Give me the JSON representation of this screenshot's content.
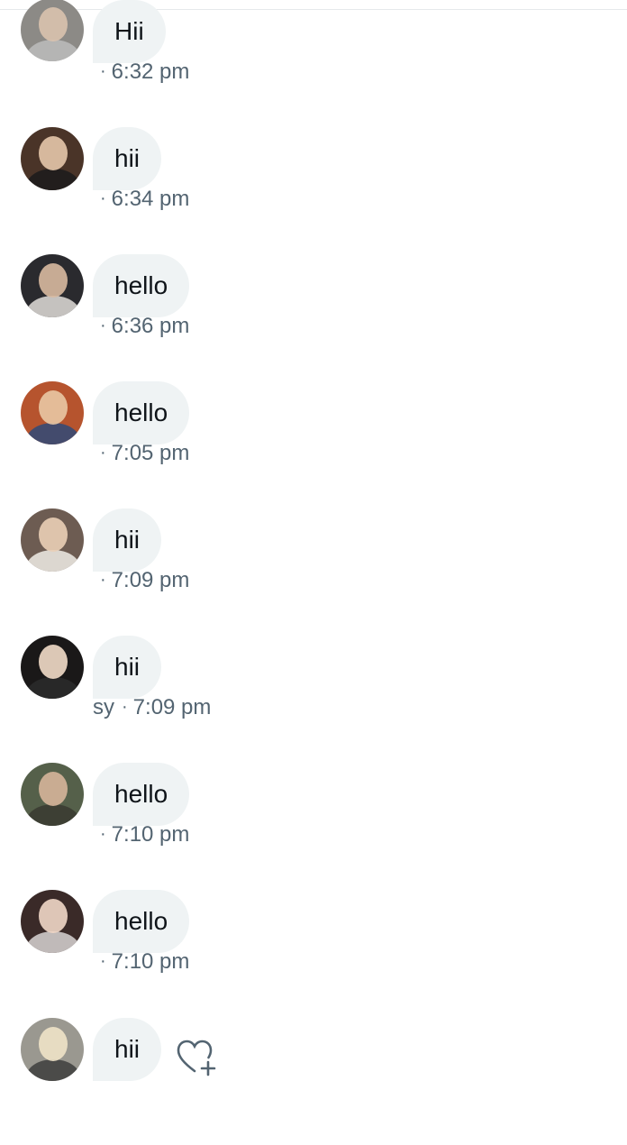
{
  "messages": [
    {
      "text": "Hii",
      "time": "6:32 pm",
      "sender_clip": "",
      "avatar": {
        "bg": "#8c8a86",
        "head": "#d9c2ae",
        "body": "#bcbcbc"
      }
    },
    {
      "text": "hii",
      "time": "6:34 pm",
      "sender_clip": "",
      "avatar": {
        "bg": "#4a3428",
        "head": "#e6c6aa",
        "body": "#1b1b1b"
      }
    },
    {
      "text": "hello",
      "time": "6:36 pm",
      "sender_clip": "",
      "avatar": {
        "bg": "#2a2a2e",
        "head": "#d8b9a0",
        "body": "#e0ddd8"
      }
    },
    {
      "text": "hello",
      "time": "7:05 pm",
      "sender_clip": "",
      "avatar": {
        "bg": "#b6542e",
        "head": "#e9c8a4",
        "body": "#2f4a78"
      }
    },
    {
      "text": "hii",
      "time": "7:09 pm",
      "sender_clip": "",
      "avatar": {
        "bg": "#6d5c52",
        "head": "#eacfb6",
        "body": "#f0ece6"
      }
    },
    {
      "text": "hii",
      "time": "7:09 pm",
      "sender_clip": "sy",
      "avatar": {
        "bg": "#1a1818",
        "head": "#f2dcc8",
        "body": "#2b2b2b"
      }
    },
    {
      "text": "hello",
      "time": "7:10 pm",
      "sender_clip": "",
      "avatar": {
        "bg": "#55604a",
        "head": "#d6b59a",
        "body": "#3a3a30"
      }
    },
    {
      "text": "hello",
      "time": "7:10 pm",
      "sender_clip": "",
      "avatar": {
        "bg": "#3a2a28",
        "head": "#f1d7c6",
        "body": "#d8d4d2"
      }
    },
    {
      "text": "hii",
      "time": "",
      "sender_clip": "",
      "avatar": {
        "bg": "#9a9890",
        "head": "#efe3c8",
        "body": "#3d3d3d"
      },
      "has_react": true
    }
  ]
}
